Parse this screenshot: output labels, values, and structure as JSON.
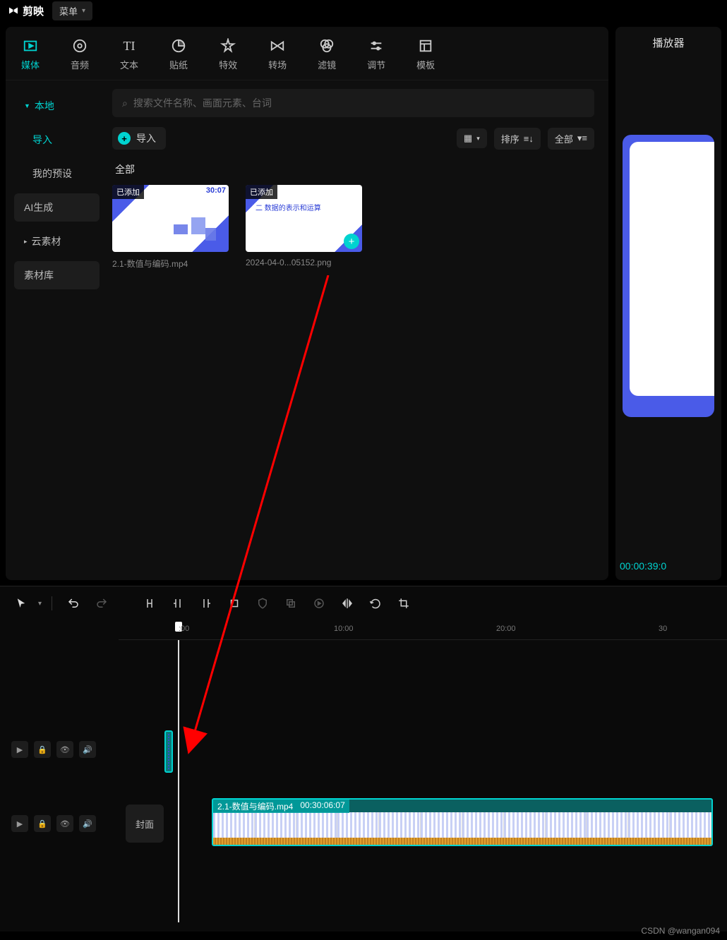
{
  "app": {
    "name": "剪映",
    "menu": "菜单"
  },
  "tabs": [
    {
      "label": "媒体",
      "active": true
    },
    {
      "label": "音频"
    },
    {
      "label": "文本"
    },
    {
      "label": "贴纸"
    },
    {
      "label": "特效"
    },
    {
      "label": "转场"
    },
    {
      "label": "滤镜"
    },
    {
      "label": "调节"
    },
    {
      "label": "模板"
    }
  ],
  "sidebar": [
    {
      "label": "本地",
      "type": "group",
      "active": true
    },
    {
      "label": "导入",
      "type": "indent",
      "active": true
    },
    {
      "label": "我的预设",
      "type": "indent"
    },
    {
      "label": "AI生成",
      "type": "btn"
    },
    {
      "label": "云素材",
      "type": "group"
    },
    {
      "label": "素材库",
      "type": "btn"
    }
  ],
  "search": {
    "placeholder": "搜索文件名称、画面元素、台词"
  },
  "toolbar": {
    "import": "导入",
    "sort": "排序",
    "filter": "全部"
  },
  "section": {
    "all": "全部"
  },
  "assets": [
    {
      "tag": "已添加",
      "duration": "30:07",
      "name": "2.1-数值与编码.mp4",
      "hint": ""
    },
    {
      "tag": "已添加",
      "duration": "",
      "name": "2024-04-0...05152.png",
      "hint": "二 数据的表示和运算",
      "add": true
    }
  ],
  "player": {
    "title": "播放器",
    "time": "00:00:39:0"
  },
  "ruler": [
    {
      "label": ":00",
      "pos": 85
    },
    {
      "label": "10:00",
      "pos": 320
    },
    {
      "label": "20:00",
      "pos": 550
    },
    {
      "label": "30",
      "pos": 778
    }
  ],
  "clip": {
    "name": "2.1-数值与编码.mp4",
    "dur": "00:30:06:07",
    "cover": "封面"
  },
  "watermark": "CSDN @wangan094"
}
